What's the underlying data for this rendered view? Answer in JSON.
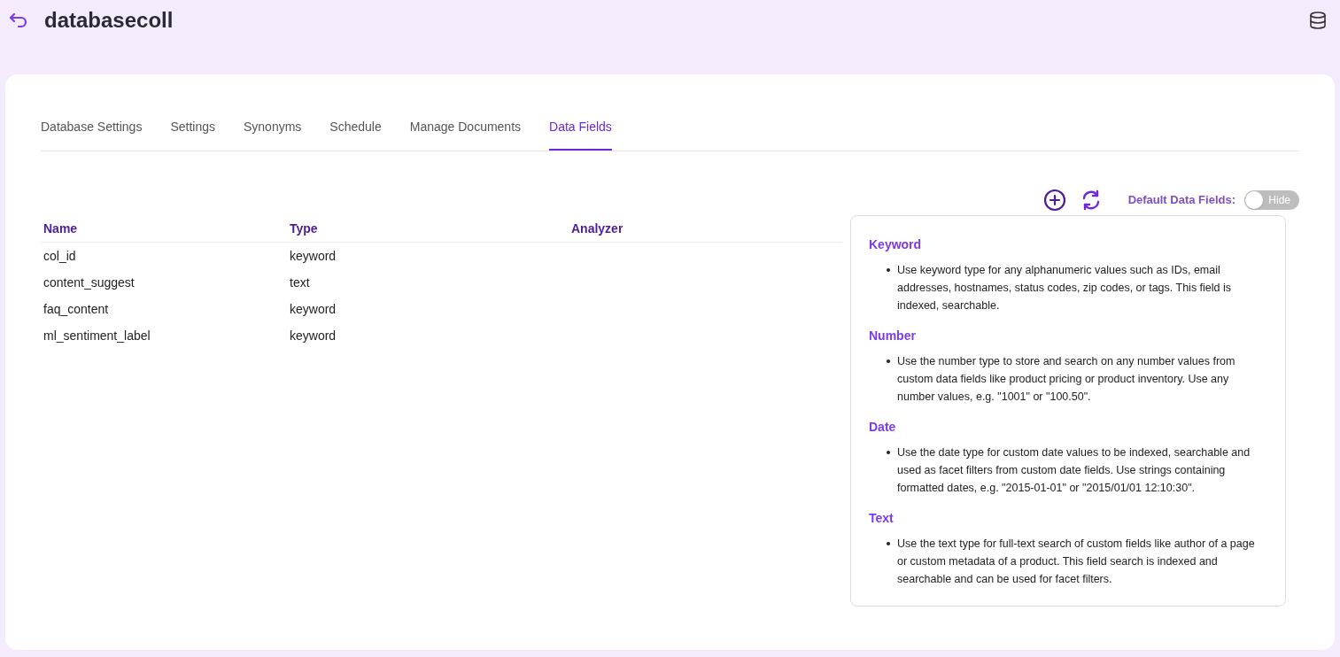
{
  "header": {
    "title": "databasecoll"
  },
  "tabs": [
    {
      "label": "Database Settings",
      "selected": false
    },
    {
      "label": "Settings",
      "selected": false
    },
    {
      "label": "Synonyms",
      "selected": false
    },
    {
      "label": "Schedule",
      "selected": false
    },
    {
      "label": "Manage Documents",
      "selected": false
    },
    {
      "label": "Data Fields",
      "selected": true
    }
  ],
  "toolbar": {
    "toggle_label": "Default Data Fields:",
    "toggle": {
      "on": false,
      "text": "Hide"
    }
  },
  "table": {
    "columns": [
      "Name",
      "Type",
      "Analyzer"
    ],
    "rows": [
      [
        "col_id",
        "keyword",
        ""
      ],
      [
        "content_suggest",
        "text",
        ""
      ],
      [
        "faq_content",
        "keyword",
        ""
      ],
      [
        "ml_sentiment_label",
        "keyword",
        ""
      ]
    ]
  },
  "help": [
    {
      "heading": "Keyword",
      "text": "Use keyword type for any alphanumeric values such as IDs, email addresses, hostnames, status codes, zip codes, or tags. This field is indexed, searchable."
    },
    {
      "heading": "Number",
      "text": "Use the number type to store and search on any number values from custom data fields like product pricing or product inventory. Use any number values, e.g. \"1001\" or \"100.50\"."
    },
    {
      "heading": "Date",
      "text": "Use the date type for custom date values to be indexed, searchable and used as facet filters from custom date fields. Use strings containing formatted dates, e.g. \"2015-01-01\" or \"2015/01/01 12:10:30\"."
    },
    {
      "heading": "Text",
      "text": "Use the text type for full-text search of custom fields like author of a page or custom metadata of a product. This field search is indexed and searchable and can be used for facet filters."
    }
  ]
}
